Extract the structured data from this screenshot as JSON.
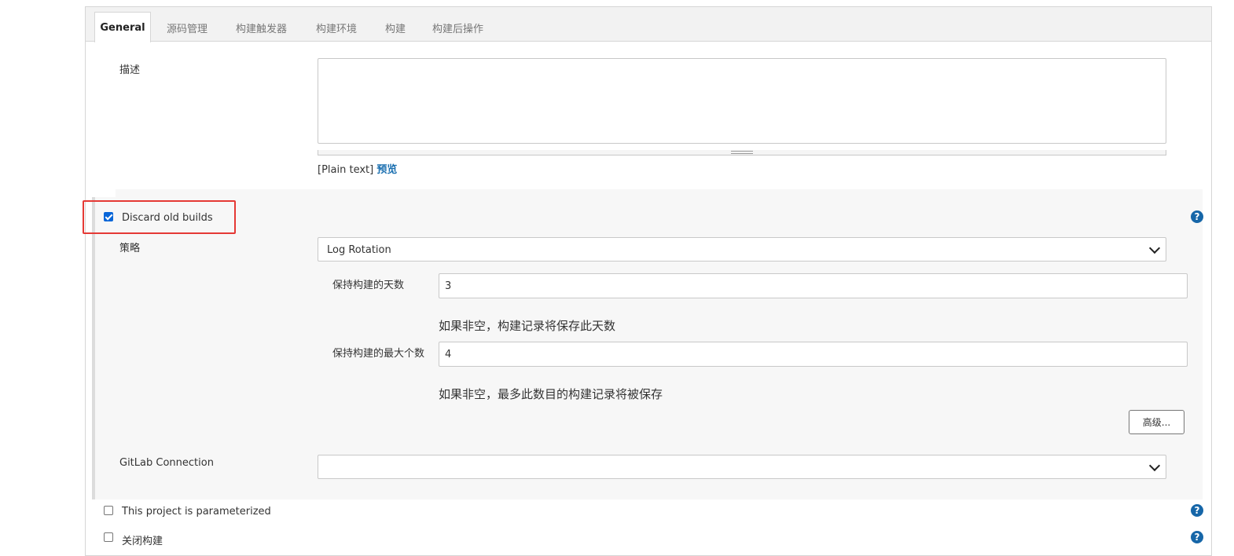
{
  "tabs": [
    {
      "label": "General",
      "active": true
    },
    {
      "label": "源码管理"
    },
    {
      "label": "构建触发器"
    },
    {
      "label": "构建环境"
    },
    {
      "label": "构建"
    },
    {
      "label": "构建后操作"
    }
  ],
  "description": {
    "label": "描述",
    "value": "",
    "format_prefix": "[Plain text]",
    "preview_link": "预览"
  },
  "discard_old_builds": {
    "label": "Discard old builds",
    "checked": true,
    "help": "?"
  },
  "strategy": {
    "label": "策略",
    "selected": "Log Rotation",
    "days_to_keep": {
      "label": "保持构建的天数",
      "value": "3",
      "hint": "如果非空，构建记录将保存此天数"
    },
    "max_builds": {
      "label": "保持构建的最大个数",
      "value": "4",
      "hint": "如果非空，最多此数目的构建记录将被保存"
    },
    "advanced_button": "高级..."
  },
  "gitlab_connection": {
    "label": "GitLab Connection",
    "selected": ""
  },
  "parameterized": {
    "label": "This project is parameterized",
    "checked": false,
    "help": "?"
  },
  "disable_build": {
    "label": "关闭构建",
    "checked": false,
    "help": "?"
  },
  "colors": {
    "accent": "#1666a8",
    "checkbox": "#0a66d8",
    "highlight": "#e53935"
  }
}
